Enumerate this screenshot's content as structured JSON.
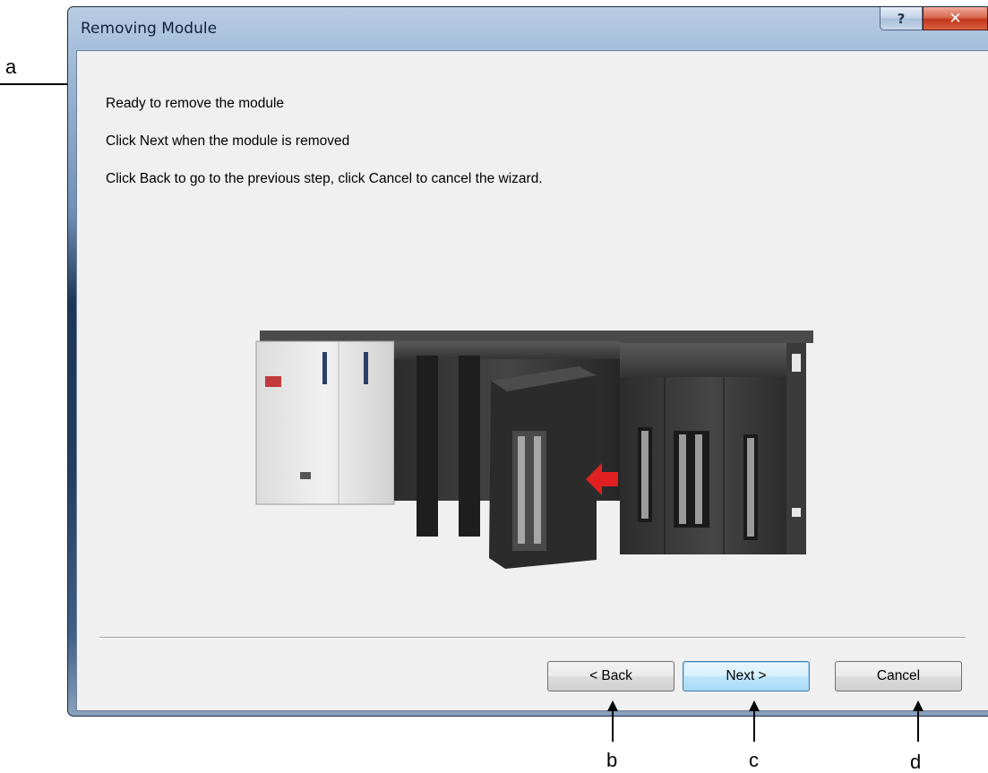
{
  "annotations": {
    "a": "a",
    "b": "b",
    "c": "c",
    "d": "d"
  },
  "window": {
    "title": "Removing Module",
    "help_glyph": "?",
    "close_glyph": "✕"
  },
  "content": {
    "line1": "Ready to remove the module",
    "line2": "Click Next when the module is removed",
    "line3": "Click Back to go to the previous step, click Cancel to cancel the wizard."
  },
  "illustration": {
    "icon": "plc-module-removal-illustration"
  },
  "buttons": {
    "back": "< Back",
    "next": "Next >",
    "cancel": "Cancel"
  },
  "colors": {
    "title_bar": "#a8c1dc",
    "client_bg": "#f0f0f0",
    "close_button": "#c2371c",
    "default_button": "#3c7fb1"
  }
}
